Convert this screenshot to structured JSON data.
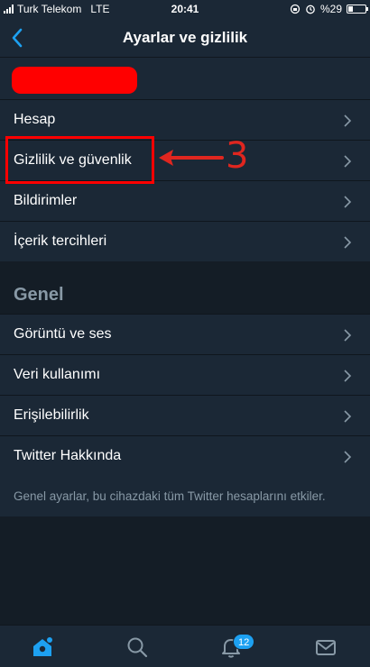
{
  "status_bar": {
    "carrier": "Turk Telekom",
    "network": "LTE",
    "time": "20:41",
    "battery": "%29",
    "battery_level": 0.29
  },
  "header": {
    "title": "Ayarlar ve gizlilik"
  },
  "settings": {
    "items": [
      {
        "label": "Hesap"
      },
      {
        "label": "Gizlilik ve güvenlik"
      },
      {
        "label": "Bildirimler"
      },
      {
        "label": "İçerik tercihleri"
      }
    ]
  },
  "general": {
    "header": "Genel",
    "items": [
      {
        "label": "Görüntü ve ses"
      },
      {
        "label": "Veri kullanımı"
      },
      {
        "label": "Erişilebilirlik"
      },
      {
        "label": "Twitter Hakkında"
      }
    ],
    "footnote": "Genel ayarlar, bu cihazdaki tüm Twitter hesaplarını etkiler."
  },
  "annotation": {
    "step": "3",
    "color": "#e0261f"
  },
  "tabbar": {
    "tabs": [
      "home-icon",
      "search-icon",
      "notifications-icon",
      "messages-icon"
    ],
    "notifications_badge": "12"
  },
  "colors": {
    "accent": "#1da1f2",
    "background": "#141d26",
    "surface": "#1b2836",
    "muted_text": "#8899a6"
  }
}
